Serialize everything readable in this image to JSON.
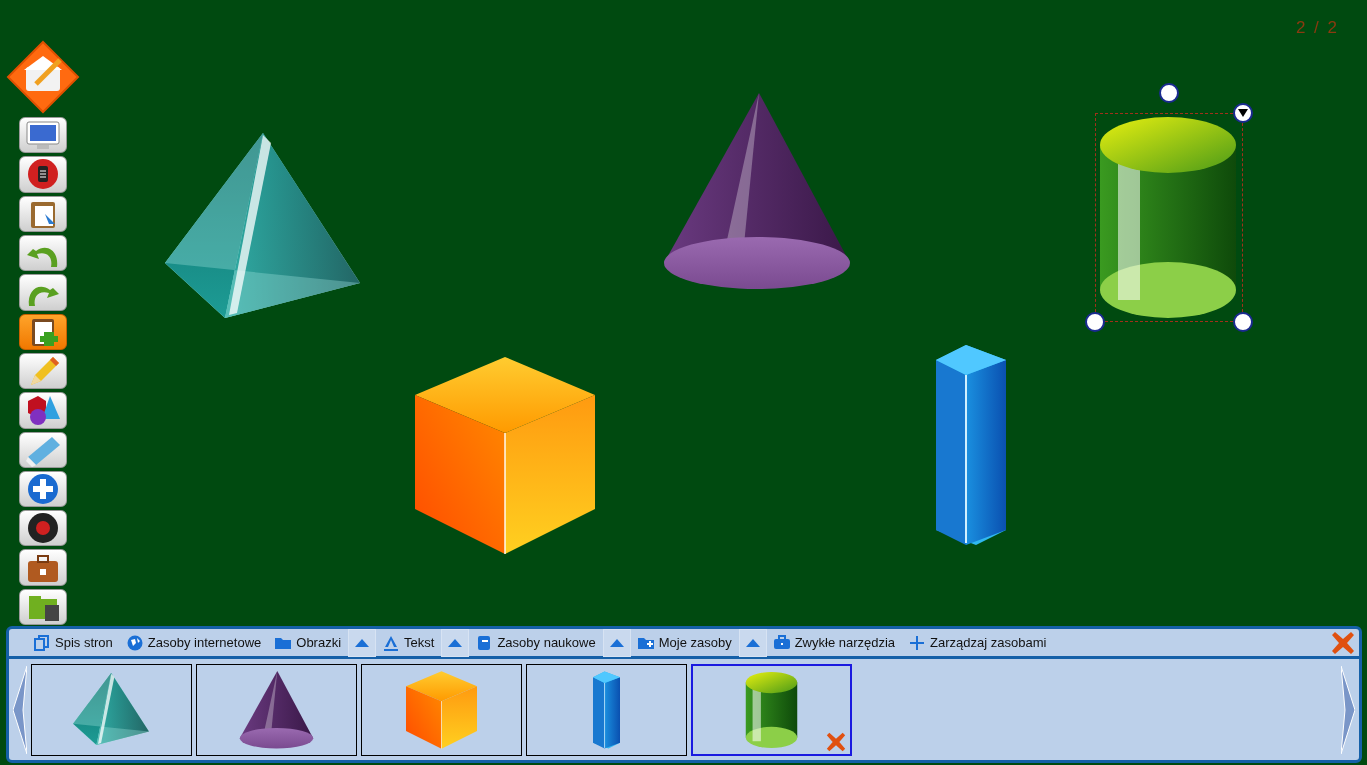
{
  "page_counter": "2 / 2",
  "toolbar": [
    {
      "kind": "home"
    },
    {
      "kind": "monitor",
      "selected": false
    },
    {
      "kind": "menu",
      "selected": false
    },
    {
      "kind": "clipboard",
      "selected": false
    },
    {
      "kind": "undo",
      "selected": false
    },
    {
      "kind": "redo",
      "selected": false
    },
    {
      "kind": "page-add",
      "selected": true
    },
    {
      "kind": "pencil",
      "selected": false
    },
    {
      "kind": "shapes",
      "selected": false
    },
    {
      "kind": "ruler",
      "selected": false
    },
    {
      "kind": "plus",
      "selected": false
    },
    {
      "kind": "record",
      "selected": false
    },
    {
      "kind": "briefcase",
      "selected": false
    },
    {
      "kind": "folder",
      "selected": false
    }
  ],
  "canvas_objects": [
    {
      "kind": "pyramid",
      "selected": false
    },
    {
      "kind": "cone",
      "selected": false
    },
    {
      "kind": "cylinder",
      "selected": true
    },
    {
      "kind": "cube",
      "selected": false
    },
    {
      "kind": "prism",
      "selected": false
    }
  ],
  "resource_tabs": [
    {
      "label": "Spis stron",
      "kind": "pages",
      "dropdown": false
    },
    {
      "label": "Zasoby internetowe",
      "kind": "globe",
      "dropdown": false
    },
    {
      "label": "Obrazki",
      "kind": "folder",
      "dropdown": true
    },
    {
      "label": "Tekst",
      "kind": "text",
      "dropdown": true
    },
    {
      "label": "Zasoby naukowe",
      "kind": "book",
      "dropdown": true
    },
    {
      "label": "Moje zasoby",
      "kind": "folder-add",
      "dropdown": true
    },
    {
      "label": "Zwykłe narzędzia",
      "kind": "briefcase",
      "dropdown": false
    },
    {
      "label": "Zarządzaj zasobami",
      "kind": "plus",
      "dropdown": false
    }
  ],
  "thumbnails": [
    {
      "kind": "pyramid",
      "selected": false
    },
    {
      "kind": "cone",
      "selected": false
    },
    {
      "kind": "cube",
      "selected": false
    },
    {
      "kind": "prism",
      "selected": false
    },
    {
      "kind": "cylinder",
      "selected": true
    }
  ]
}
